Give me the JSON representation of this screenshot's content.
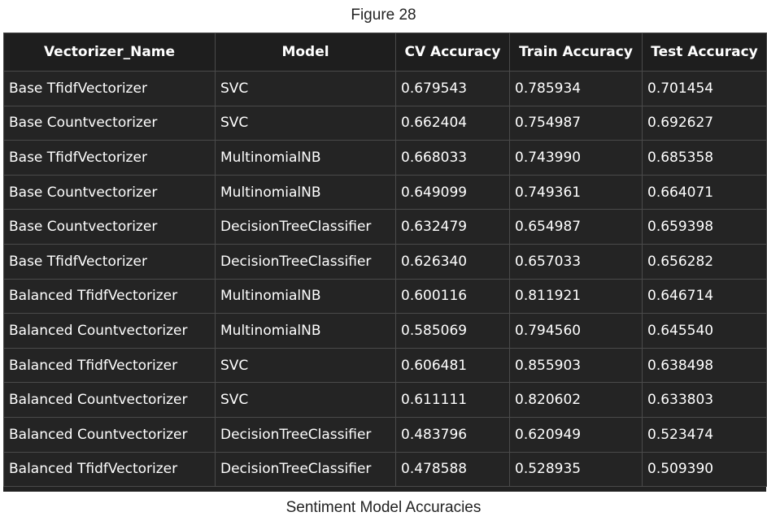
{
  "figure_label": "Figure 28",
  "caption": "Sentiment Model Accuracies",
  "table": {
    "headers": [
      "Vectorizer_Name",
      "Model",
      "CV Accuracy",
      "Train Accuracy",
      "Test Accuracy"
    ],
    "rows": [
      [
        "Base TfidfVectorizer",
        "SVC",
        "0.679543",
        "0.785934",
        "0.701454"
      ],
      [
        "Base Countvectorizer",
        "SVC",
        "0.662404",
        "0.754987",
        "0.692627"
      ],
      [
        "Base TfidfVectorizer",
        "MultinomialNB",
        "0.668033",
        "0.743990",
        "0.685358"
      ],
      [
        "Base Countvectorizer",
        "MultinomialNB",
        "0.649099",
        "0.749361",
        "0.664071"
      ],
      [
        "Base Countvectorizer",
        "DecisionTreeClassifier",
        "0.632479",
        "0.654987",
        "0.659398"
      ],
      [
        "Base TfidfVectorizer",
        "DecisionTreeClassifier",
        "0.626340",
        "0.657033",
        "0.656282"
      ],
      [
        "Balanced TfidfVectorizer",
        "MultinomialNB",
        "0.600116",
        "0.811921",
        "0.646714"
      ],
      [
        "Balanced Countvectorizer",
        "MultinomialNB",
        "0.585069",
        "0.794560",
        "0.645540"
      ],
      [
        "Balanced TfidfVectorizer",
        "SVC",
        "0.606481",
        "0.855903",
        "0.638498"
      ],
      [
        "Balanced Countvectorizer",
        "SVC",
        "0.611111",
        "0.820602",
        "0.633803"
      ],
      [
        "Balanced Countvectorizer",
        "DecisionTreeClassifier",
        "0.483796",
        "0.620949",
        "0.523474"
      ],
      [
        "Balanced TfidfVectorizer",
        "DecisionTreeClassifier",
        "0.478588",
        "0.528935",
        "0.509390"
      ]
    ]
  },
  "colors": {
    "table_background": "#222222",
    "header_background": "#1e1e1e",
    "cell_text": "#ffffff",
    "grid_lines": "#4a4a4a",
    "page_text": "#222222"
  }
}
